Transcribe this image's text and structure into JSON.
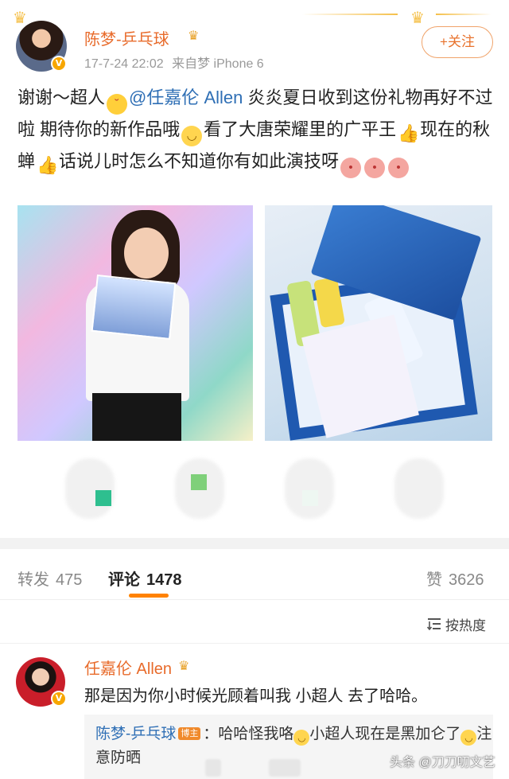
{
  "post": {
    "author_name": "陈梦-乒乓球",
    "timestamp": "17-7-24 22:02",
    "source": "来自梦 iPhone 6",
    "follow_label": "+关注",
    "text_segments": {
      "part1": "谢谢～超人",
      "mention": "@任嘉伦 Allen",
      "part2": "炎炎夏日收到这份礼物再好不过啦 期待你的新作品哦",
      "part3": "看了大唐荣耀里的广平王",
      "part4": "现在的秋蝉",
      "part5": "话说儿时怎么不知道你有如此演技呀"
    },
    "icons": {
      "verified": "verified-v-icon",
      "vip": "crown-vip-icon",
      "emoji_tongue": "tongue-emoji-icon",
      "emoji_smile": "smile-emoji-icon",
      "emoji_thumb": "thumbs-up-emoji-icon",
      "emoji_pig": "pig-emoji-icon"
    },
    "verified_glyph": "V",
    "crown_glyph": "♛"
  },
  "tabs": {
    "repost": {
      "label": "转发",
      "count": "475"
    },
    "comment": {
      "label": "评论",
      "count": "1478"
    },
    "like": {
      "label": "赞",
      "count": "3626"
    }
  },
  "sort": {
    "label": "按热度",
    "icon": "sort-icon"
  },
  "comment": {
    "author_name": "任嘉伦 Allen",
    "text": "那是因为你小时候光顾着叫我 小超人 去了哈哈。",
    "reply": {
      "author_name": "陈梦-乒乓球",
      "badge": "博主",
      "part1": "：哈哈怪我咯",
      "part2": "小超人现在是黑加仑了",
      "part3": "注意防晒"
    }
  },
  "watermark": "头条 @刀刀叨文艺",
  "colors": {
    "accent_orange": "#ff8200",
    "name_orange": "#e86b2b",
    "link_blue": "#2f6fb5"
  }
}
